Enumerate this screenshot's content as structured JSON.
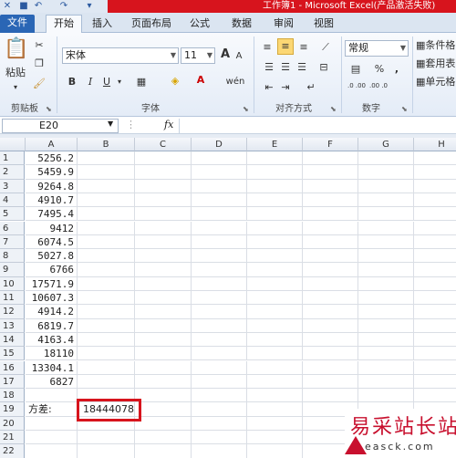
{
  "window": {
    "title": "工作簿1 - Microsoft Excel(产品激活失败)"
  },
  "tabs": [
    "文件",
    "开始",
    "插入",
    "页面布局",
    "公式",
    "数据",
    "审阅",
    "视图"
  ],
  "ribbon": {
    "clipboard": {
      "label": "剪贴板",
      "paste": "粘贴"
    },
    "font": {
      "label": "字体",
      "name": "宋体",
      "size": "11",
      "bold": "B",
      "italic": "I",
      "underline": "U",
      "grow": "A",
      "shrink": "A",
      "pinyin": "wén"
    },
    "alignment": {
      "label": "对齐方式"
    },
    "number": {
      "label": "数字",
      "format": "常规",
      "percent": "%",
      "comma": ",",
      "inc_decimal": ".0 .00",
      "dec_decimal": ".00 .0"
    },
    "styles": {
      "conditional": "条件格",
      "table": "套用表",
      "cell": "单元格"
    }
  },
  "formula_bar": {
    "name_box": "E20",
    "fx": "fx",
    "value": ""
  },
  "columns": [
    "A",
    "B",
    "C",
    "D",
    "E",
    "F",
    "G",
    "H"
  ],
  "rows": [
    "1",
    "2",
    "3",
    "4",
    "5",
    "6",
    "7",
    "8",
    "9",
    "10",
    "11",
    "12",
    "13",
    "14",
    "15",
    "16",
    "17",
    "18",
    "19",
    "20",
    "21",
    "22"
  ],
  "col_a_values": [
    "5256.2",
    "5459.9",
    "9264.8",
    "4910.7",
    "7495.4",
    "9412",
    "6074.5",
    "5027.8",
    "6766",
    "17571.9",
    "10607.3",
    "4914.2",
    "6819.7",
    "4163.4",
    "18110",
    "13304.1",
    "6827"
  ],
  "variance_label": "方差:",
  "variance_value": "18444078",
  "colors": {
    "file_tab": "#2a66b5",
    "title_band": "#d7141d",
    "highlight": "#d7141d"
  },
  "watermark": {
    "text": "易采站长站",
    "sub": "easck.com"
  }
}
